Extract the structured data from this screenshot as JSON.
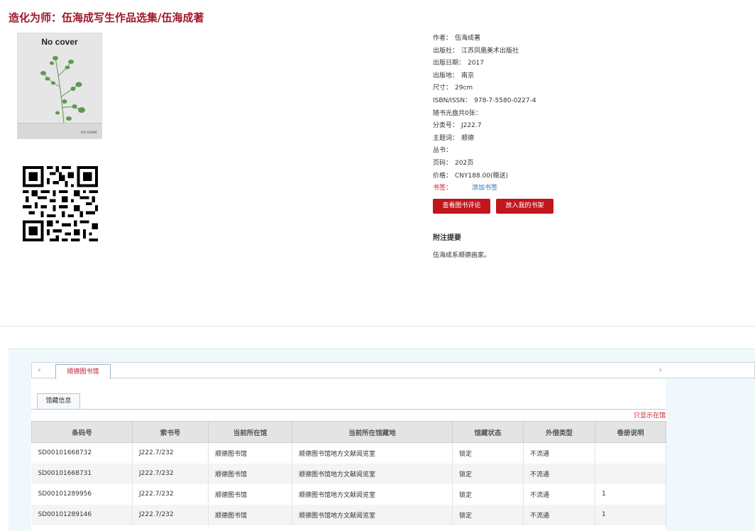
{
  "title": "造化为师：伍海成写生作品选集/伍海成著",
  "cover": {
    "title": "No cover",
    "footer": "no cover"
  },
  "meta": [
    {
      "label": "作者：",
      "value": "伍海成著"
    },
    {
      "label": "出版社：",
      "value": "江苏凤凰美术出版社"
    },
    {
      "label": "出版日期：",
      "value": "2017"
    },
    {
      "label": "出版地：",
      "value": "南京"
    },
    {
      "label": "尺寸：",
      "value": "29cm"
    },
    {
      "label": "ISBN/ISSN：",
      "value": "978-7-5580-0227-4"
    },
    {
      "label": "随书光盘共0张：",
      "value": ""
    },
    {
      "label": "分类号：",
      "value": "J222.7"
    },
    {
      "label": "主题词：",
      "value": "顺德"
    },
    {
      "label": "丛书：",
      "value": ""
    },
    {
      "label": "页码：",
      "value": "202页"
    },
    {
      "label": "价格：",
      "value": "CNY188.00(赠送)"
    }
  ],
  "bookmark": {
    "label": "书签：",
    "link": "添加书签"
  },
  "buttons": {
    "review": "查看图书评论",
    "shelf": "放入我的书架"
  },
  "notes": {
    "heading": "附注提要",
    "text": "伍海成系顺德画家。"
  },
  "holdings": {
    "library_tab": "顺德图书馆",
    "info_tab": "馆藏信息",
    "only_show": "只显示在馆",
    "columns": [
      "条码号",
      "索书号",
      "当前所在馆",
      "当前所在馆藏地",
      "馆藏状态",
      "外借类型",
      "卷册说明"
    ],
    "rows": [
      [
        "SD00101668732",
        "J222.7/232",
        "顺德图书馆",
        "顺德图书馆地方文献阅览室",
        "锁定",
        "不流通",
        ""
      ],
      [
        "SD00101668731",
        "J222.7/232",
        "顺德图书馆",
        "顺德图书馆地方文献阅览室",
        "锁定",
        "不流通",
        ""
      ],
      [
        "SD00101289956",
        "J222.7/232",
        "顺德图书馆",
        "顺德图书馆地方文献阅览室",
        "锁定",
        "不流通",
        "1"
      ],
      [
        "SD00101289146",
        "J222.7/232",
        "顺德图书馆",
        "顺德图书馆地方文献阅览室",
        "锁定",
        "不流通",
        "1"
      ]
    ]
  },
  "colors": {
    "accent": "#c0161c",
    "title": "#a0192b",
    "link": "#2a74b5"
  }
}
